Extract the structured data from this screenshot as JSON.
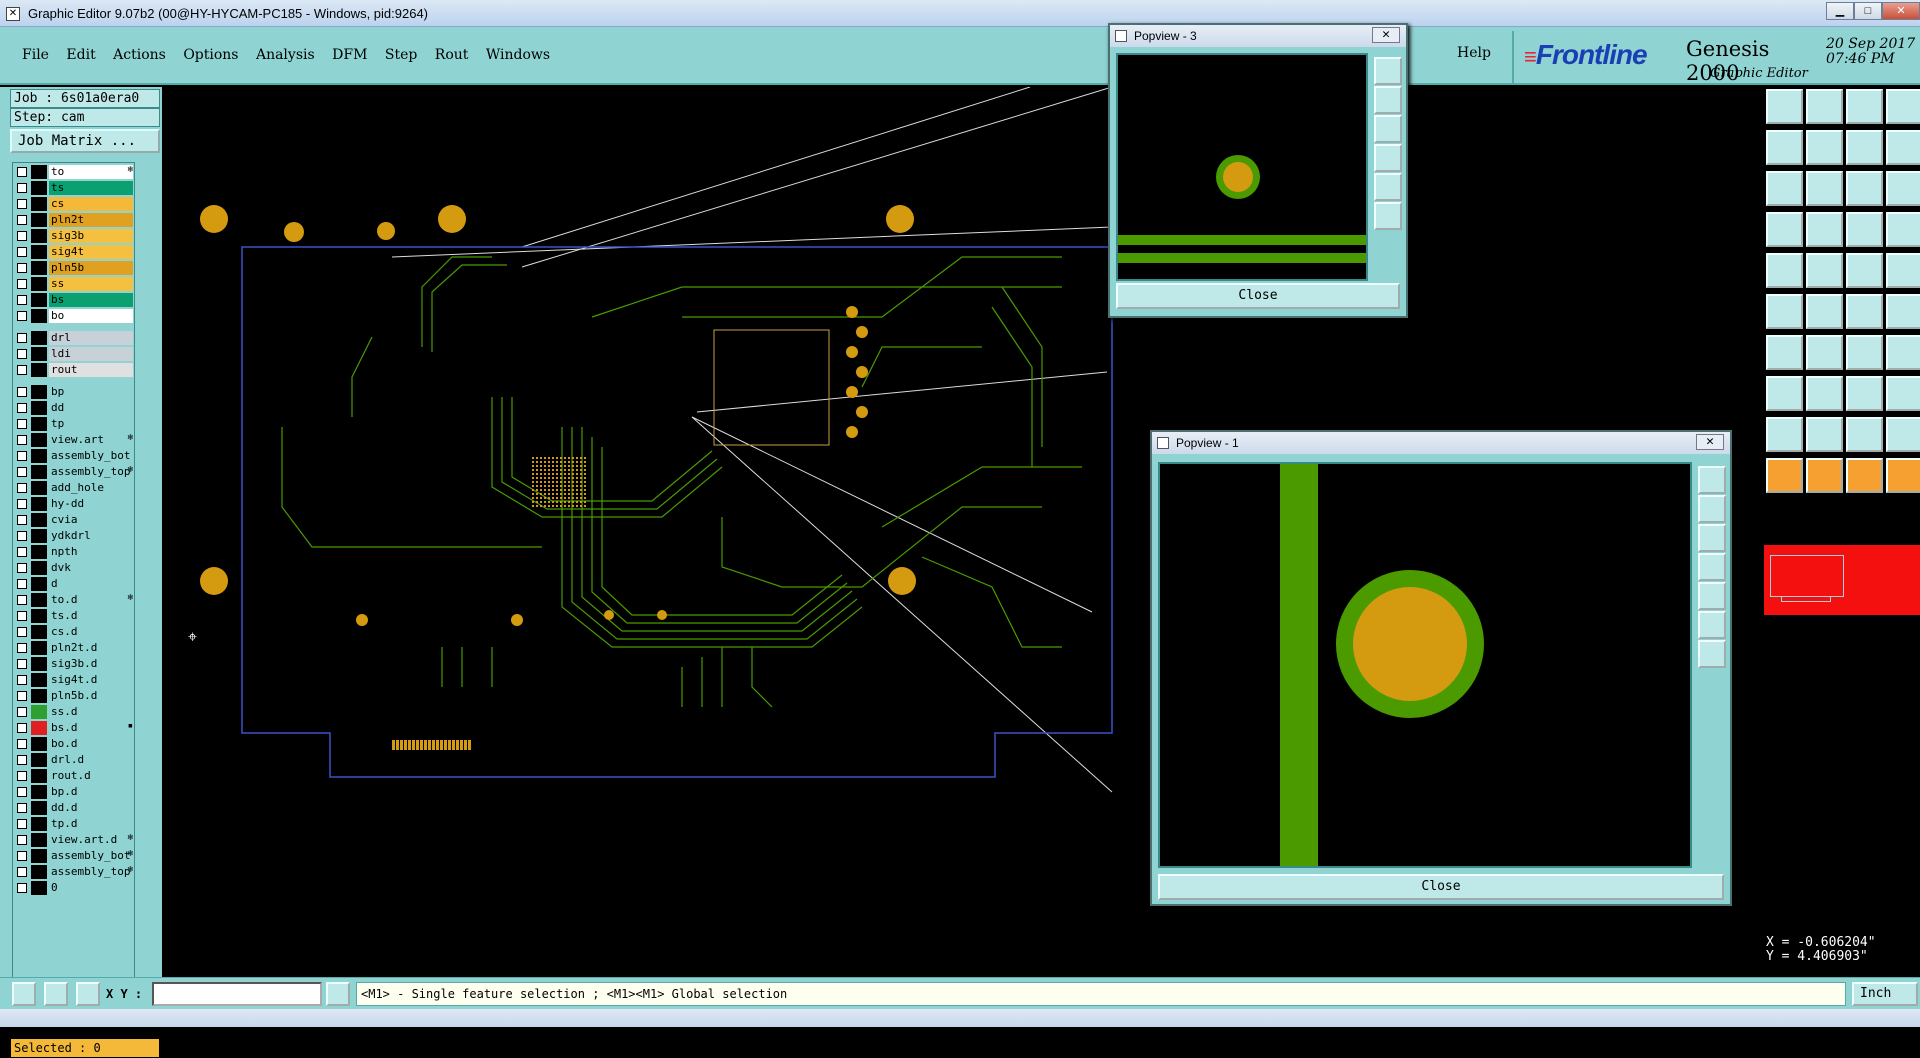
{
  "window": {
    "title": "Graphic Editor 9.07b2 (00@HY-HYCAM-PC185 - Windows, pid:9264)",
    "min": "▁",
    "max": "□",
    "close": "✕"
  },
  "menu": {
    "items": [
      "File",
      "Edit",
      "Actions",
      "Options",
      "Analysis",
      "DFM",
      "Step",
      "Rout",
      "Windows"
    ],
    "help": "Help"
  },
  "brand": {
    "frontline": "Frontline",
    "product": "Genesis 2000",
    "subtitle": "Graphic Editor",
    "date": "20 Sep 2017",
    "time": "07:46 PM"
  },
  "job": {
    "job_label": "Job : 6s01a0era0",
    "step_label": "Step: cam",
    "matrix_button": "Job Matrix ..."
  },
  "layers": [
    {
      "name": "to",
      "color": "#ffffff",
      "bg": "#ffffff",
      "mark": "❄"
    },
    {
      "name": "ts",
      "color": "#0aa070",
      "bg": "#0aa070",
      "mark": ""
    },
    {
      "name": "cs",
      "color": "#f5b93a",
      "bg": "#f5b93a",
      "mark": ""
    },
    {
      "name": "pln2t",
      "color": "#e0a020",
      "bg": "#e0a020",
      "mark": ""
    },
    {
      "name": "sig3b",
      "color": "#f5c040",
      "bg": "#f5c040",
      "mark": ""
    },
    {
      "name": "sig4t",
      "color": "#f5c040",
      "bg": "#f5c040",
      "mark": ""
    },
    {
      "name": "pln5b",
      "color": "#e0a020",
      "bg": "#e0a020",
      "mark": ""
    },
    {
      "name": "ss",
      "color": "#f5c040",
      "bg": "#f5c040",
      "mark": ""
    },
    {
      "name": "bs",
      "color": "#0aa070",
      "bg": "#0aa070",
      "mark": ""
    },
    {
      "name": "bo",
      "color": "#ffffff",
      "bg": "#ffffff",
      "mark": ""
    },
    {
      "name": "drl",
      "color": "#c8d0d8",
      "bg": "#c8d0d8",
      "mark": ""
    },
    {
      "name": "ldi",
      "color": "#c8d0d8",
      "bg": "#c8d0d8",
      "mark": ""
    },
    {
      "name": "rout",
      "color": "#e0e0e0",
      "bg": "#e0e0e0",
      "mark": ""
    },
    {
      "name": "bp",
      "color": "#8fd3d3",
      "bg": "#8fd3d3",
      "mark": ""
    },
    {
      "name": "dd",
      "color": "#8fd3d3",
      "bg": "#8fd3d3",
      "mark": ""
    },
    {
      "name": "tp",
      "color": "#8fd3d3",
      "bg": "#8fd3d3",
      "mark": ""
    },
    {
      "name": "view.art",
      "color": "#8fd3d3",
      "bg": "#8fd3d3",
      "mark": "❄"
    },
    {
      "name": "assembly_bot",
      "color": "#8fd3d3",
      "bg": "#8fd3d3",
      "mark": ""
    },
    {
      "name": "assembly_top",
      "color": "#8fd3d3",
      "bg": "#8fd3d3",
      "mark": "❄"
    },
    {
      "name": "add_hole",
      "color": "#8fd3d3",
      "bg": "#8fd3d3",
      "mark": ""
    },
    {
      "name": "hy-dd",
      "color": "#8fd3d3",
      "bg": "#8fd3d3",
      "mark": ""
    },
    {
      "name": "cvia",
      "color": "#8fd3d3",
      "bg": "#8fd3d3",
      "mark": ""
    },
    {
      "name": "ydkdrl",
      "color": "#8fd3d3",
      "bg": "#8fd3d3",
      "mark": ""
    },
    {
      "name": "npth",
      "color": "#8fd3d3",
      "bg": "#8fd3d3",
      "mark": ""
    },
    {
      "name": "dvk",
      "color": "#8fd3d3",
      "bg": "#8fd3d3",
      "mark": ""
    },
    {
      "name": "d",
      "color": "#8fd3d3",
      "bg": "#8fd3d3",
      "mark": ""
    },
    {
      "name": "to.d",
      "color": "#8fd3d3",
      "bg": "#8fd3d3",
      "mark": "❄"
    },
    {
      "name": "ts.d",
      "color": "#8fd3d3",
      "bg": "#8fd3d3",
      "mark": ""
    },
    {
      "name": "cs.d",
      "color": "#8fd3d3",
      "bg": "#8fd3d3",
      "mark": ""
    },
    {
      "name": "pln2t.d",
      "color": "#8fd3d3",
      "bg": "#8fd3d3",
      "mark": ""
    },
    {
      "name": "sig3b.d",
      "color": "#8fd3d3",
      "bg": "#8fd3d3",
      "mark": ""
    },
    {
      "name": "sig4t.d",
      "color": "#8fd3d3",
      "bg": "#8fd3d3",
      "mark": ""
    },
    {
      "name": "pln5b.d",
      "color": "#8fd3d3",
      "bg": "#8fd3d3",
      "mark": ""
    },
    {
      "name": "ss.d",
      "color": "#2fa02f",
      "bg": "#8fd3d3",
      "mark": ""
    },
    {
      "name": "bs.d",
      "color": "#e02020",
      "bg": "#8fd3d3",
      "mark": "▪"
    },
    {
      "name": "bo.d",
      "color": "#8fd3d3",
      "bg": "#8fd3d3",
      "mark": ""
    },
    {
      "name": "drl.d",
      "color": "#8fd3d3",
      "bg": "#8fd3d3",
      "mark": ""
    },
    {
      "name": "rout.d",
      "color": "#8fd3d3",
      "bg": "#8fd3d3",
      "mark": ""
    },
    {
      "name": "bp.d",
      "color": "#8fd3d3",
      "bg": "#8fd3d3",
      "mark": ""
    },
    {
      "name": "dd.d",
      "color": "#8fd3d3",
      "bg": "#8fd3d3",
      "mark": ""
    },
    {
      "name": "tp.d",
      "color": "#8fd3d3",
      "bg": "#8fd3d3",
      "mark": ""
    },
    {
      "name": "view.art.d",
      "color": "#8fd3d3",
      "bg": "#8fd3d3",
      "mark": "❄"
    },
    {
      "name": "assembly_bot.d",
      "color": "#8fd3d3",
      "bg": "#8fd3d3",
      "mark": "❄"
    },
    {
      "name": "assembly_top.d",
      "color": "#8fd3d3",
      "bg": "#8fd3d3",
      "mark": "❄"
    },
    {
      "name": "0",
      "color": "#8fd3d3",
      "bg": "#8fd3d3",
      "mark": ""
    }
  ],
  "status": {
    "selected": "Selected : 0",
    "xy_label": "X Y :",
    "message": "<M1> - Single feature selection ; <M1><M1> Global selection",
    "unit": "Inch"
  },
  "coords": {
    "x": "X = -0.606204\"",
    "y": "Y = 4.406903\""
  },
  "popup3": {
    "title": "Popview - 3",
    "close_label": "Close"
  },
  "popup1": {
    "title": "Popview - 1",
    "close_label": "Close"
  },
  "colors": {
    "panel": "#8fd3d3",
    "pad": "#d49a10",
    "trace": "#4a9a00",
    "outline": "#3b52c8"
  }
}
